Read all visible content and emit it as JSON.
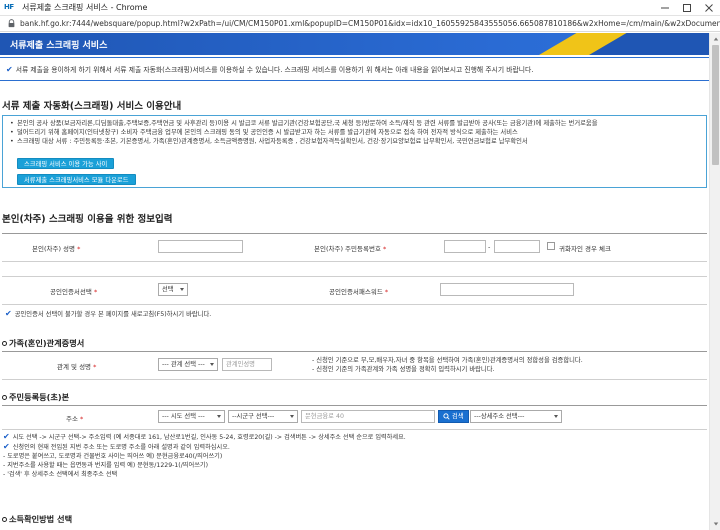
{
  "window": {
    "app_icon_text": "HF",
    "title": "서류제출 스크래핑 서비스 - Chrome",
    "url": "bank.hf.go.kr:7444/websquare/popup.html?w2xPath=/ui/CM/CM150P01.xml&popupID=CM150P01&idx=idx10_16055925843555056.665087810186&w2xHome=/cm/main/&w2xDocumentRoot="
  },
  "banner": {
    "title": "서류제출 스크래핑 서비스"
  },
  "notice": {
    "text": "서류 제출을 용이하게 하기 위해서 서류 제출 자동화(스크래핑)서비스를 이용하실 수 있습니다. 스크래핑 서비스를 이용하기 위 해서는 아래 내용을 읽어보시고 진행해 주시기 바랍니다."
  },
  "guide": {
    "heading": "서류 제출 자동화(스크래핑) 서비스 이용안내",
    "items": [
      "본인의 공사 상품(보금자리론,디딤돌대출,주택보증,주택연금 및 사후관리 등)이용 시 발급코 서류 발급기관(건강보험공단,국 세청 등)방문하여 소득/재직 등 관련 서류를 발급받아 공사(또는 금융기관)에 제출하는 번거로움을",
      "덜어드리기 위해 홈페이지(인터넷창구) 소비자 주택금융 업무에 본인의 스크래핑 동의 및 공인인증 시 발급받고자 하는 서류를 발급기관에 자동으로 접속 하여 전자적 방식으로 제출하는 서비스",
      "스크래핑 대상 서류 : 주민등록등·초본, 기본증명서, 가족(혼인)관계증명서, 소득금액증명원, 사업자등록증 , 건강보험자격득실확인서, 건강·장기요양보험료 납부확인서, 국민연금보험료 납부확인서"
    ],
    "btn_sites": "스크래핑 서비스 이용 가능 사이",
    "btn_download": "서류제출 스크래핑서비스 모듈 다운로드"
  },
  "form": {
    "heading": "본인(차주) 스크래핑 이용을 위한 정보입력",
    "name_label": "본인(차주) 성명",
    "rrn_label": "본인(차주) 주민등록번호",
    "rrn_dash": "-",
    "foreigner_label": "귀화자인 경우 체크",
    "cert_select_label": "공인인증서선택",
    "cert_select_value": "선택",
    "cert_pw_label": "공인인증서패스워드",
    "cert_note": "공인인증서 선택이 불가할 경우 본 페이지를 새로고침(F5)하시기 바랍니다.",
    "family": {
      "heading": "가족(혼인)관계증명서",
      "relation_label": "관계 및 성명",
      "relation_select": "--- 관계 선택 ---",
      "relation_name_placeholder": "관계인성명",
      "note1": "- 신청인 기준으로 부,모,배우자,자녀 중 항목을 선택하여 가족(혼인)관계증명서의 정합성을 검증합니다.",
      "note2": "- 신청인 기준의 가족관계와 가족 성명을 정확히 입력하시기 바랍니다."
    },
    "resident": {
      "heading": "주민등록등(초)본",
      "address_label": "주소",
      "sido_select": "--- 시도 선택 ---",
      "sigungu_select": "--시군구 선택---",
      "road_placeholder": "문현금융로 40",
      "search_label": "검색",
      "detail_select": "---상세주소 선택---",
      "notes": [
        "시도 선택 -> 시군구 선택-> 주소입력 (예 서종대로 161, 남산로1번길, 인사동 5-24, 효령로20(길) -> 검색버튼 -> 상세주소 선택 순으로 입력하세요.",
        "신청인의 현재 전입된 지번 주소 또는 도로명 주소를 아래 설명과 같이 입력하십시오.",
        "- 도로명은 붙여쓰고, 도로명과 건물번호 사이는 띄어쓰 예) 문현금융로40(/띄어쓰기)",
        "- 지번주소를 사용할 때는 읍면동과 번지를 입력 예) 문현동/1229-1(/띄어쓰기)",
        "- '검색' 후 상세주소 선택에서 최종주소 선택"
      ]
    },
    "income_heading": "소득확인방법 선택"
  }
}
